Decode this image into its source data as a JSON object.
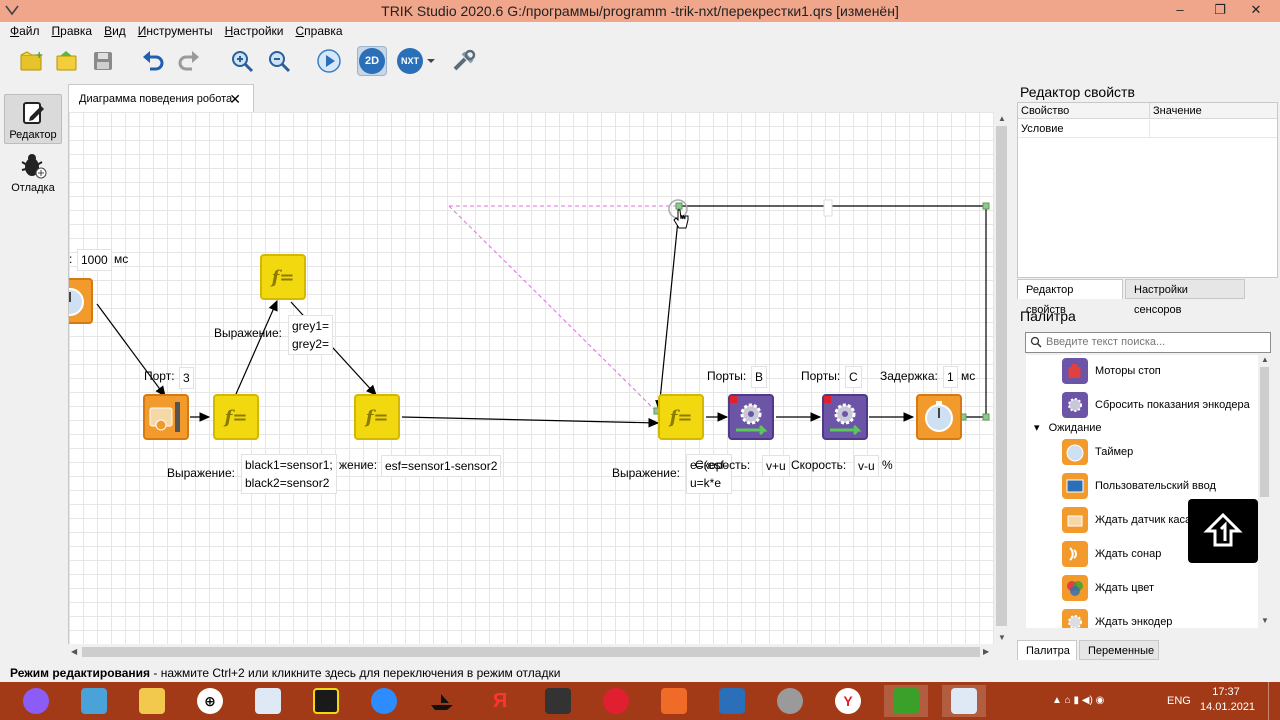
{
  "window": {
    "title": "TRIK Studio 2020.6 G:/программы/programm -trik-nxt/перекрестки1.qrs [изменён]",
    "minimize": "‒",
    "maximize": "❐",
    "close": "✕"
  },
  "menu": [
    {
      "u": "Ф",
      "rest": "айл"
    },
    {
      "u": "П",
      "rest": "равка"
    },
    {
      "u": "В",
      "rest": "ид"
    },
    {
      "u": "И",
      "rest": "нструменты"
    },
    {
      "u": "Н",
      "rest": "астройки"
    },
    {
      "u": "С",
      "rest": "правка"
    }
  ],
  "toolbar": {
    "mode2d": "2D",
    "modeNxt": "NXT"
  },
  "dock": {
    "editor": "Редактор",
    "debug": "Отладка"
  },
  "tab": {
    "label": "Диаграмма поведения робота",
    "close": "✕"
  },
  "diagram": {
    "timer_prefix": ":",
    "timer_value": "1000",
    "timer_unit": "мс",
    "port_label": "Порт:",
    "port_value": "3",
    "expr_label_top": "Выражение:",
    "expr_top_l1": "grey1=",
    "expr_top_l2": "grey2=",
    "expr_label_bottom": "Выражение:",
    "expr_bottom_l1": "black1=sensor1;",
    "expr_bottom_l2": "black2=sensor2",
    "expr_mid_label": "жение:",
    "expr_mid_value": "esf=sensor1-sensor2",
    "expr_right_label": "Выражение:",
    "expr_right_l1": "e=(esf-",
    "expr_right_l2": "u=k*e",
    "portsB_label": "Порты:",
    "portsB_value": "B",
    "portsC_label": "Порты:",
    "portsC_value": "C",
    "delay_label": "Задержка:",
    "delay_value": "1",
    "delay_unit": "мс",
    "speed1_label": "Скорость:",
    "speed1_value": "v+u",
    "speed2_label": "Скорость:",
    "speed2_value": "v-u",
    "speed2_unit": "%"
  },
  "props": {
    "title": "Редактор свойств",
    "col_property": "Свойство",
    "col_value": "Значение",
    "row1_property": "Условие",
    "row1_value": "",
    "tab_props": "Редактор свойств",
    "tab_sensors": "Настройки сенсоров"
  },
  "palette": {
    "title": "Палитра",
    "search_placeholder": "Введите текст поиска...",
    "items_top": [
      "Моторы стоп",
      "Сбросить показания энкодера"
    ],
    "group": "Ожидание",
    "items_wait": [
      "Таймер",
      "Пользовательский ввод",
      "Ждать датчик касания",
      "Ждать сонар",
      "Ждать цвет",
      "Ждать энкодер"
    ],
    "tab_palette": "Палитра",
    "tab_vars": "Переменные"
  },
  "status": {
    "mode": "Режим редактирования",
    "hint": " - нажмите Ctrl+2 или кликните здесь для переключения в режим отладки"
  },
  "taskbar": {
    "lang": "ENG",
    "time": "17:37",
    "date": "14.01.2021",
    "yandex_letter": "Я"
  },
  "colors": {
    "titlebar": "#f0a68a",
    "taskbar": "#a23a17",
    "function_block": "#f2d90f",
    "timer_block": "#f29a2c",
    "motor_block": "#6c55a6"
  }
}
